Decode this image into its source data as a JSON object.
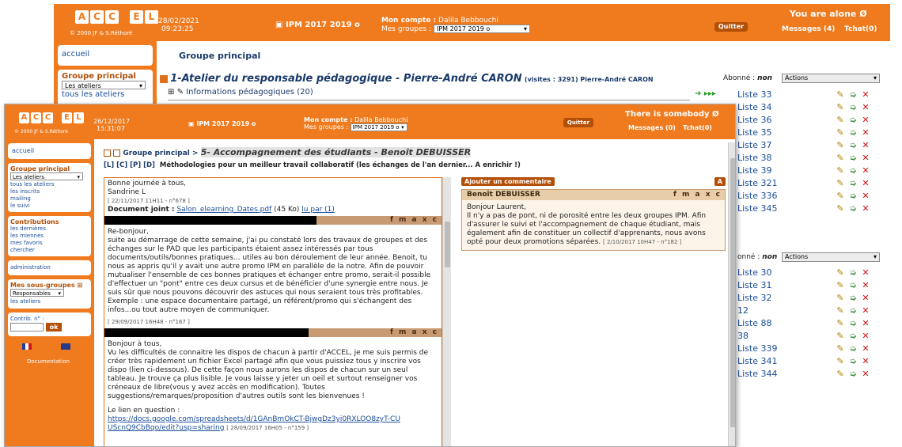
{
  "back": {
    "header": {
      "logo": "ACC EL",
      "logo_sub": "© 2000 JF & S.Réthoré",
      "date": "28/02/2021",
      "time": "09:23:25",
      "group": "IPM 2017 2019 o",
      "account_label": "Mon compte :",
      "account_name": "Dalila Bebbouchi",
      "groups_label": "Mes groupes :",
      "groups_value": "IPM 2017 2019 o",
      "quit": "Quitter",
      "alone": "You are alone",
      "messages": "Messages (4)",
      "tchat": "Tchat(0)"
    },
    "sidebar": {
      "accueil": "accueil",
      "gp_title": "Groupe principal",
      "select": "Les ateliers",
      "tous": "tous les ateliers"
    },
    "main": {
      "title": "Groupe principal",
      "atelier_title": "1-Atelier du responsable pédagogique - Pierre-André CARON",
      "visites": "(visites : 3291) Pierre-André CARON",
      "info_row": "Informations pédagogiques (20)",
      "abonne_label": "Abonné :",
      "abonne_val": "non",
      "actions": "Actions",
      "abonne2_label": "onné :",
      "abonne2_val": "non",
      "actions2": "Actions",
      "lists1": [
        "Liste 33",
        "Liste 34",
        "Liste 36",
        "Liste 35",
        "Liste 37",
        "Liste 38",
        "Liste 39",
        "Liste 321",
        "Liste 336",
        "Liste 345"
      ],
      "lists2": [
        "Liste 30",
        "Liste 31",
        "Liste 32",
        "12",
        "Liste 88",
        "38",
        "Liste 339",
        "Liste 341",
        "Liste 344"
      ]
    }
  },
  "front": {
    "header": {
      "logo": "ACC EL",
      "logo_sub": "© 2000 JF & S.Réthoré",
      "date": "26/12/2017",
      "time": "15:31:07",
      "group": "IPM 2017 2019 o",
      "account_label": "Mon compte :",
      "account_name": "Dalila Bebbouchi",
      "groups_label": "Mes groupes :",
      "groups_value": "IPM 2017 2019 o",
      "quit": "Quitter",
      "somebody": "There is somebody",
      "messages": "Messages (0)",
      "tchat": "Tchat(0)"
    },
    "sidebar": {
      "accueil": "accueil",
      "gp_title": "Groupe principal",
      "select": "Les ateliers",
      "links": [
        "tous les ateliers",
        "les inscrits",
        "mailing",
        "le suivi"
      ],
      "contrib_title": "Contributions",
      "contrib_links": [
        "les dernières",
        "les miennes",
        "mes favoris",
        "chercher"
      ],
      "admin": "administration",
      "sg_title": "Mes sous-groupes",
      "sg_select": "Responsables",
      "sg_link": "les ateliers",
      "contrib_n": "Contrib. n° :",
      "ok": "ok",
      "documentation": "Documentation"
    },
    "main": {
      "breadcrumb_root": "Groupe principal >",
      "breadcrumb_current": "5- Accompagnement des étudiants - Benoît DEBUISSER",
      "tabs": [
        "[L]",
        "[C]",
        "[P]",
        "[D]"
      ],
      "topic": "Méthodologies pour un meilleur travail collaboratif (les échanges de l'an dernier... A enrichir !)",
      "msg1": {
        "l1": "Bonne journée à tous,",
        "l2": "Sandrine L",
        "date": "[ 22/11/2017 11H11 - n°678 ]",
        "doc_label": "Document joint :",
        "doc_link": "Salon_elearning_Dates.pdf",
        "doc_size": "(45 Ko)",
        "lu": "lu par (1)"
      },
      "fmaxc": "f m a x c",
      "msg2": "Re-bonjour,\nsuite au démarrage de cette semaine, j'ai pu constaté lors des travaux de groupes et des échanges sur le PAD que les participants étaient assez intéressés par tous documents/outils/bonnes pratiques... utiles au bon déroulement de leur année. Benoit, tu nous as appris qu'il y avait une autre promo IPM en parallèle de la notre. Afin de pouvoir mutualiser l'ensemble de ces bonnes pratiques et échanger entre promo, serait-il possible d'effectuer un \"pont\" entre ces deux cursus et de bénéficier d'une synergie entre nous. Je suis sûr que nous pouvons découvrir des astuces qui nous seraient tous très profitables.\nExemple : une espace documentaire partagé, un référent/promo qui s'échangent des infos...ou tout autre moyen de communiquer.",
      "msg2_date": "[ 29/09/2017 16H48 - n°167 ]",
      "msg3": "Bonjour à tous,\nVu les difficultés de connaitre les dispos de chacun à partir d'ACCEL, je me suis permis de créer très rapidement un fichier Excel partagé afin que vous puissiez tous y inscrire vos dispo (lien ci-dessous). De cette façon nous aurons les dispos de chacun sur un seul tableau. Je trouve ça plus lisible. Je vous laisse y jeter un oeil et surtout renseigner vos créneaux de libre(vous y avez accès en modification). Toutes suggestions/remarques/proposition d'autres outils sont les bienvenues !",
      "msg3_link_label": "Le lien en question :",
      "msg3_link": "https://docs.google.com/spreadsheets/d/1GAnBmOkCT-BjwgDz3yi0RXLOO8zyT-CUUScnQ9CbBqo/edit?usp=sharing",
      "msg3_date": "[ 28/09/2017 16H05 - n°159 ]",
      "add_comment": "Ajouter un commentaire",
      "add_a": "A",
      "comment_author": "Benoît DEBUISSER",
      "comment_text": "Bonjour Laurent,\nIl n'y a pas de pont, ni de porosité entre les deux groupes IPM. Afin d'assurer le suivi et l'accompagnement de chaque étudiant, mais également afin de constituer un collectif d'apprenants, nous avons opté pour deux promotions séparées.",
      "comment_date": "[ 2/10/2017 10H47 - n°182 ]"
    }
  },
  "colors": {
    "orange": "#f07b1e",
    "dark_orange": "#b34f07",
    "tan": "#c89a73",
    "link": "#1a4d99"
  }
}
